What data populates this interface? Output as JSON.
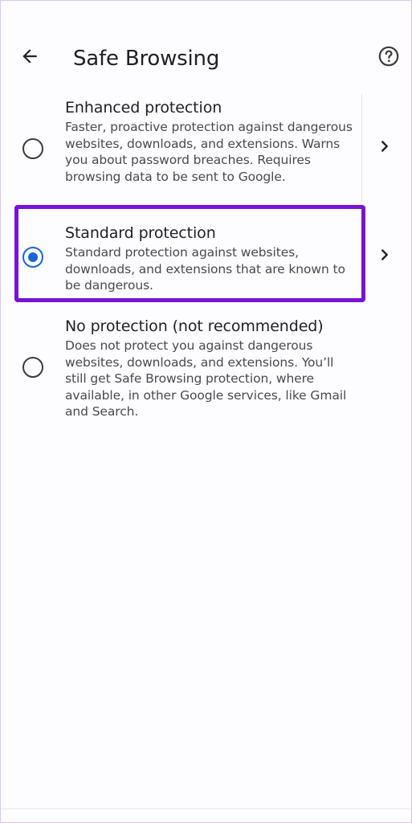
{
  "toolbar": {
    "back_icon": "arrow-back-icon",
    "title": "Safe Browsing",
    "help_icon": "help-circle-icon"
  },
  "options": [
    {
      "title": "Enhanced protection",
      "description": "Faster, proactive protection against dangerous websites, downloads, and extensions. Warns you about password breaches. Requires browsing data to be sent to Google.",
      "selected": false,
      "has_details": true
    },
    {
      "title": "Standard protection",
      "description": "Standard protection against websites, downloads, and extensions that are known to be dangerous.",
      "selected": true,
      "has_details": true,
      "highlighted": true
    },
    {
      "title": "No protection (not recommended)",
      "description": "Does not protect you against dangerous websites, downloads, and extensions. You’ll still get Safe Browsing protection, where available, in other Google services, like Gmail and Search.",
      "selected": false,
      "has_details": false
    }
  ],
  "colors": {
    "accent": "#1a66d2",
    "highlight_border": "#7a12d6",
    "text_primary": "#202124",
    "text_secondary": "#4a4a4d"
  }
}
